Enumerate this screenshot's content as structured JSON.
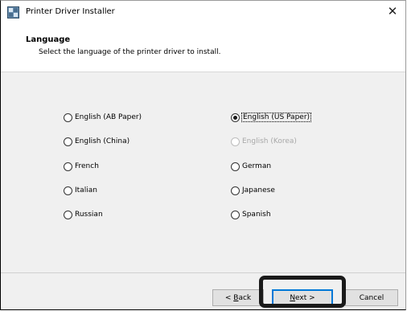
{
  "window": {
    "title": "Printer Driver Installer"
  },
  "header": {
    "title": "Language",
    "description": "Select the language of the printer driver to install."
  },
  "options": [
    {
      "label": "English (AB Paper)",
      "checked": false,
      "enabled": true
    },
    {
      "label": "English (US Paper)",
      "checked": true,
      "enabled": true
    },
    {
      "label": "English (China)",
      "checked": false,
      "enabled": true
    },
    {
      "label": "English (Korea)",
      "checked": false,
      "enabled": false
    },
    {
      "label": "French",
      "checked": false,
      "enabled": true
    },
    {
      "label": "German",
      "checked": false,
      "enabled": true
    },
    {
      "label": "Italian",
      "checked": false,
      "enabled": true
    },
    {
      "label": "Japanese",
      "checked": false,
      "enabled": true
    },
    {
      "label": "Russian",
      "checked": false,
      "enabled": true
    },
    {
      "label": "Spanish",
      "checked": false,
      "enabled": true
    }
  ],
  "buttons": {
    "back": {
      "prefix": "< ",
      "accel": "B",
      "rest": "ack"
    },
    "next": {
      "accel": "N",
      "rest": "ext >"
    },
    "cancel": "Cancel"
  }
}
